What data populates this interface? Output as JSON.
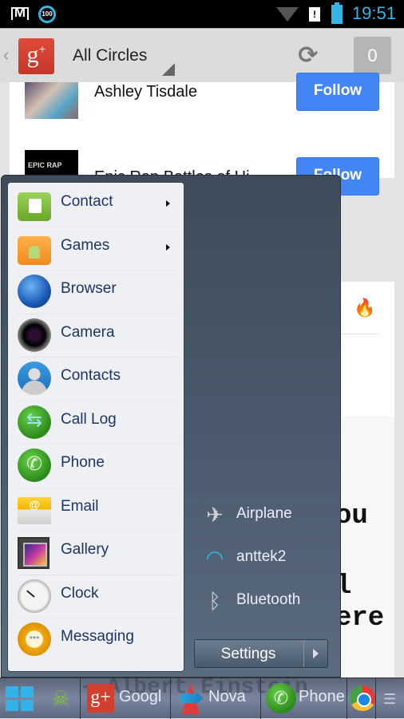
{
  "status_bar": {
    "time": "19:51",
    "battery_notification": "100",
    "icons": [
      "gmail-icon",
      "battery-level-icon",
      "wifi-icon",
      "sim-alert-icon",
      "battery-icon"
    ]
  },
  "action_bar": {
    "back_glyph": "‹",
    "app_logo": "g+",
    "circle_filter": "All Circles",
    "refresh_glyph": "⟳",
    "notification_count": "0"
  },
  "feed": {
    "suggestions": [
      {
        "name": "Ashley Tisdale",
        "button": "Follow"
      },
      {
        "name": "Epic Rap Battles of Hi",
        "button": "Follow",
        "thumb_text": "EPIC RAP"
      }
    ],
    "flame_glyph": "🔥",
    "quote_fragments": [
      "ou",
      "l",
      "ere"
    ],
    "quote_attribution": "- Albert Einstein"
  },
  "start_menu": {
    "apps": [
      {
        "label": "Contact",
        "icon": "contact-folder-icon",
        "has_submenu": true
      },
      {
        "label": "Games",
        "icon": "games-folder-icon",
        "has_submenu": true
      },
      {
        "label": "Browser",
        "icon": "globe-icon",
        "has_submenu": false
      },
      {
        "label": "Camera",
        "icon": "camera-icon",
        "has_submenu": false
      },
      {
        "label": "Contacts",
        "icon": "contacts-icon",
        "has_submenu": false
      },
      {
        "label": "Call Log",
        "icon": "call-log-icon",
        "has_submenu": false
      },
      {
        "label": "Phone",
        "icon": "phone-icon",
        "has_submenu": false
      },
      {
        "label": "Email",
        "icon": "email-icon",
        "has_submenu": false
      },
      {
        "label": "Gallery",
        "icon": "gallery-icon",
        "has_submenu": false
      },
      {
        "label": "Clock",
        "icon": "clock-icon",
        "has_submenu": false
      },
      {
        "label": "Messaging",
        "icon": "messaging-icon",
        "has_submenu": false
      }
    ],
    "quick_settings": [
      {
        "label": "Airplane",
        "glyph": "✈"
      },
      {
        "label": "anttek2",
        "glyph": "◠"
      },
      {
        "label": "Bluetooth",
        "glyph": "ᛒ"
      }
    ],
    "settings_label": "Settings"
  },
  "taskbar": {
    "start_glyph": "windows",
    "pirate_glyph": "☠",
    "items": [
      {
        "label": "Googl",
        "icon": "google-plus-icon",
        "logo": "g+"
      },
      {
        "label": "Nova",
        "icon": "nova-launcher-icon"
      },
      {
        "label": "Phone",
        "icon": "phone-icon",
        "glyph": "✆"
      }
    ],
    "menu_glyph": "☰"
  },
  "colors": {
    "accent_blue": "#33b5e5",
    "follow_blue": "#4285f4",
    "gplus_red": "#d23f2e",
    "menu_text": "#1d3563"
  }
}
